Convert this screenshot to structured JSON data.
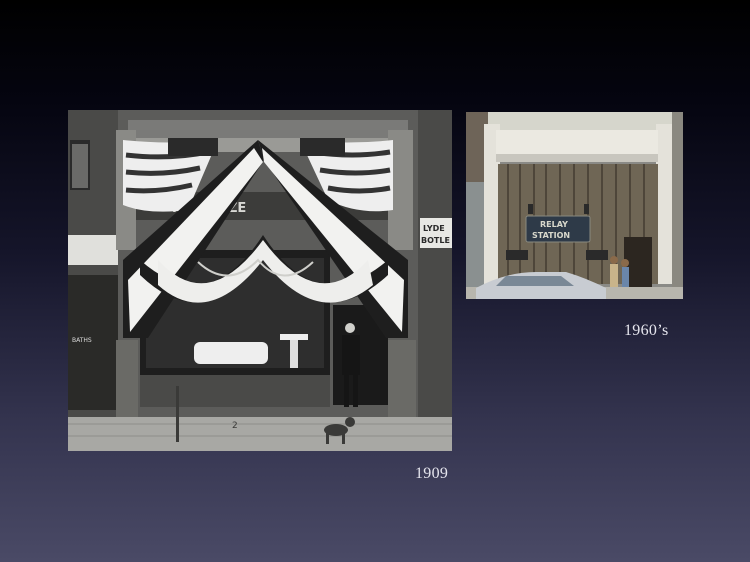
{
  "slide": {
    "background_top": "#000000",
    "background_bottom": "#4a4a66"
  },
  "photos": [
    {
      "id": "storefront-1909",
      "description_kind": "black-and-white photograph",
      "caption": "1909",
      "signs": {
        "storefront_sign": "HN  HULZE",
        "side_sign_line1": "LYDE",
        "side_sign_line2": "BOTLE",
        "left_door_sign": "BATHS",
        "sidewalk_mark": "2"
      }
    },
    {
      "id": "storefront-1960s",
      "description_kind": "color photograph",
      "caption": "1960’s",
      "signs": {
        "storefront_sign_line1": "RELAY",
        "storefront_sign_line2": "STATION"
      }
    }
  ]
}
